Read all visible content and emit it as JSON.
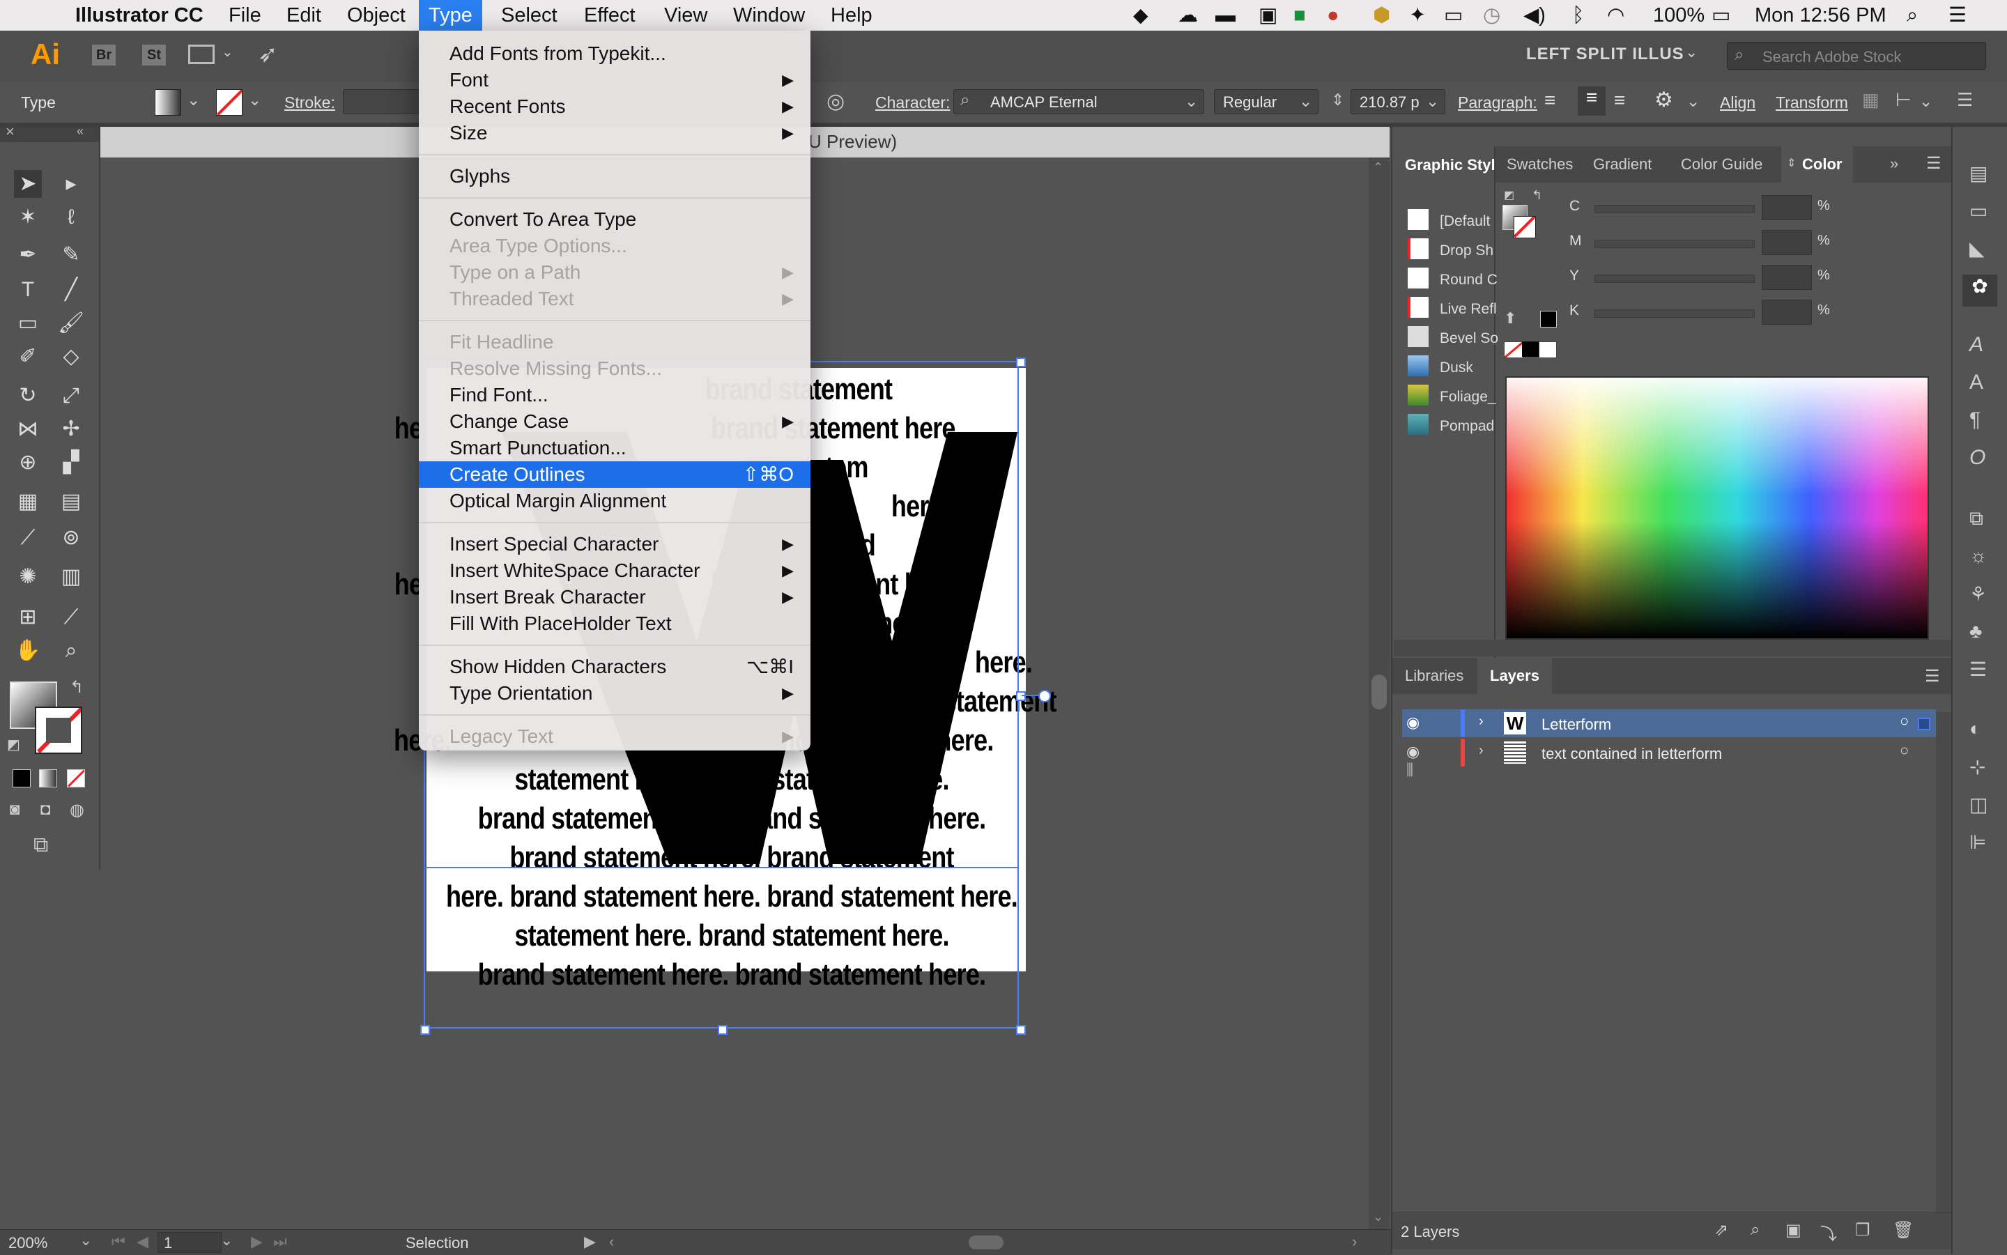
{
  "menubar": {
    "app_name": "Illustrator CC",
    "items": [
      "File",
      "Edit",
      "Object",
      "Type",
      "Select",
      "Effect",
      "View",
      "Window",
      "Help"
    ],
    "battery": "100%",
    "clock": "Mon 12:56 PM"
  },
  "appbar": {
    "logo": "Ai",
    "bridge": "Br",
    "stock": "St",
    "workspace": "LEFT SPLIT ILLUS",
    "search_placeholder": "Search Adobe Stock"
  },
  "ctrlbar": {
    "tool_label": "Type",
    "stroke_label": "Stroke:",
    "character_label": "Character:",
    "font_name": "AMCAP Eternal",
    "font_style": "Regular",
    "font_size": "210.87 p",
    "paragraph_label": "Paragraph:",
    "align_label": "Align",
    "transform_label": "Transform"
  },
  "doc_tab": {
    "title_fragment": "U Preview)"
  },
  "type_menu": {
    "items": [
      {
        "label": "Add Fonts from Typekit...",
        "disabled": false,
        "submenu": false,
        "shortcut": ""
      },
      {
        "label": "Font",
        "disabled": false,
        "submenu": true,
        "shortcut": ""
      },
      {
        "label": "Recent Fonts",
        "disabled": false,
        "submenu": true,
        "shortcut": ""
      },
      {
        "label": "Size",
        "disabled": false,
        "submenu": true,
        "shortcut": ""
      },
      {
        "label": "Glyphs",
        "disabled": false,
        "submenu": false,
        "shortcut": ""
      },
      {
        "label": "Convert To Area Type",
        "disabled": false,
        "submenu": false,
        "shortcut": ""
      },
      {
        "label": "Area Type Options...",
        "disabled": true,
        "submenu": false,
        "shortcut": ""
      },
      {
        "label": "Type on a Path",
        "disabled": true,
        "submenu": true,
        "shortcut": ""
      },
      {
        "label": "Threaded Text",
        "disabled": true,
        "submenu": true,
        "shortcut": ""
      },
      {
        "label": "Fit Headline",
        "disabled": true,
        "submenu": false,
        "shortcut": ""
      },
      {
        "label": "Resolve Missing Fonts...",
        "disabled": true,
        "submenu": false,
        "shortcut": ""
      },
      {
        "label": "Find Font...",
        "disabled": false,
        "submenu": false,
        "shortcut": ""
      },
      {
        "label": "Change Case",
        "disabled": false,
        "submenu": true,
        "shortcut": ""
      },
      {
        "label": "Smart Punctuation...",
        "disabled": false,
        "submenu": false,
        "shortcut": ""
      },
      {
        "label": "Create Outlines",
        "disabled": false,
        "submenu": false,
        "shortcut": "⇧⌘O",
        "highlighted": true
      },
      {
        "label": "Optical Margin Alignment",
        "disabled": false,
        "submenu": false,
        "shortcut": ""
      },
      {
        "label": "Insert Special Character",
        "disabled": false,
        "submenu": true,
        "shortcut": ""
      },
      {
        "label": "Insert WhiteSpace Character",
        "disabled": false,
        "submenu": true,
        "shortcut": ""
      },
      {
        "label": "Insert Break Character",
        "disabled": false,
        "submenu": true,
        "shortcut": ""
      },
      {
        "label": "Fill With PlaceHolder Text",
        "disabled": false,
        "submenu": false,
        "shortcut": ""
      },
      {
        "label": "Show Hidden Characters",
        "disabled": false,
        "submenu": false,
        "shortcut": "⌥⌘I"
      },
      {
        "label": "Type Orientation",
        "disabled": false,
        "submenu": true,
        "shortcut": ""
      },
      {
        "label": "Legacy Text",
        "disabled": true,
        "submenu": true,
        "shortcut": ""
      }
    ]
  },
  "canvas": {
    "lines": [
      "brand statement",
      "brand statement here.",
      "statem",
      "here.",
      "brand",
      "brand statement here.",
      "statement",
      "here.",
      "statement",
      "here. brand statement here.",
      "statement here. brand statement here.",
      "brand statement here. brand statement here.",
      "brand statement here. brand statement",
      "here. brand statement here. brand statement here.",
      "statement here. brand statement here.",
      "brand statement here. brand statement here."
    ],
    "left_fragments": [
      "he",
      "he",
      "here."
    ]
  },
  "graphic_styles": {
    "title": "Graphic Styl",
    "items": [
      "[Default",
      "Drop Sh",
      "Round C",
      "Live Refl",
      "Bevel So",
      "Dusk",
      "Foliage_",
      "Pompad"
    ]
  },
  "color_panel": {
    "tabs": [
      "Swatches",
      "Gradient",
      "Color Guide",
      "Color"
    ],
    "channels": [
      "C",
      "M",
      "Y",
      "K"
    ],
    "pct": "%"
  },
  "layers_panel": {
    "tabs": [
      "Libraries",
      "Layers"
    ],
    "layers": [
      {
        "name": "Letterform",
        "thumb": "W",
        "color": "#4a7bf0",
        "selected": true
      },
      {
        "name": "text contained in letterform",
        "thumb": "",
        "color": "#e8463c",
        "selected": false
      }
    ],
    "footer": "2 Layers"
  },
  "statusbar": {
    "zoom": "200%",
    "page": "1",
    "mode": "Selection"
  },
  "colors": {
    "menu_highlight": "#1d6ee9",
    "panel_bg": "#535353",
    "menubar_bg": "#eceaea"
  }
}
